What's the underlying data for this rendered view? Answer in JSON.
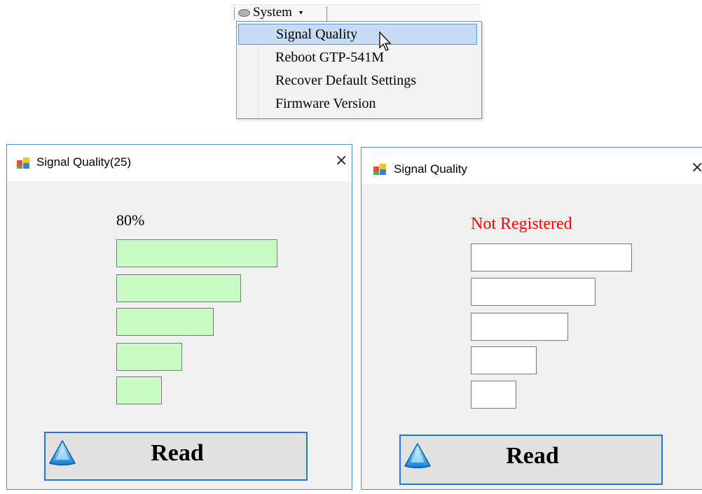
{
  "menu": {
    "label": "System",
    "items": [
      "Signal Quality",
      "Reboot GTP-541M",
      "Recover Default Settings",
      "Firmware Version"
    ],
    "selected_index": 0,
    "icons": {
      "menu": "disk-icon",
      "caret": "caret-down-icon",
      "cursor": "mouse-pointer-icon"
    }
  },
  "dialog_left": {
    "title": "Signal Quality(25)",
    "close_label": "×",
    "signal_percent": "80%",
    "bars_total": 5,
    "bars_lit": 5,
    "bar_color": "#c8fbc6",
    "read_label": "Read"
  },
  "dialog_right": {
    "title": "Signal Quality",
    "close_label": "×",
    "status": "Not Registered",
    "status_color": "#ff0000",
    "bars_total": 5,
    "bars_lit": 0,
    "read_label": "Read"
  }
}
